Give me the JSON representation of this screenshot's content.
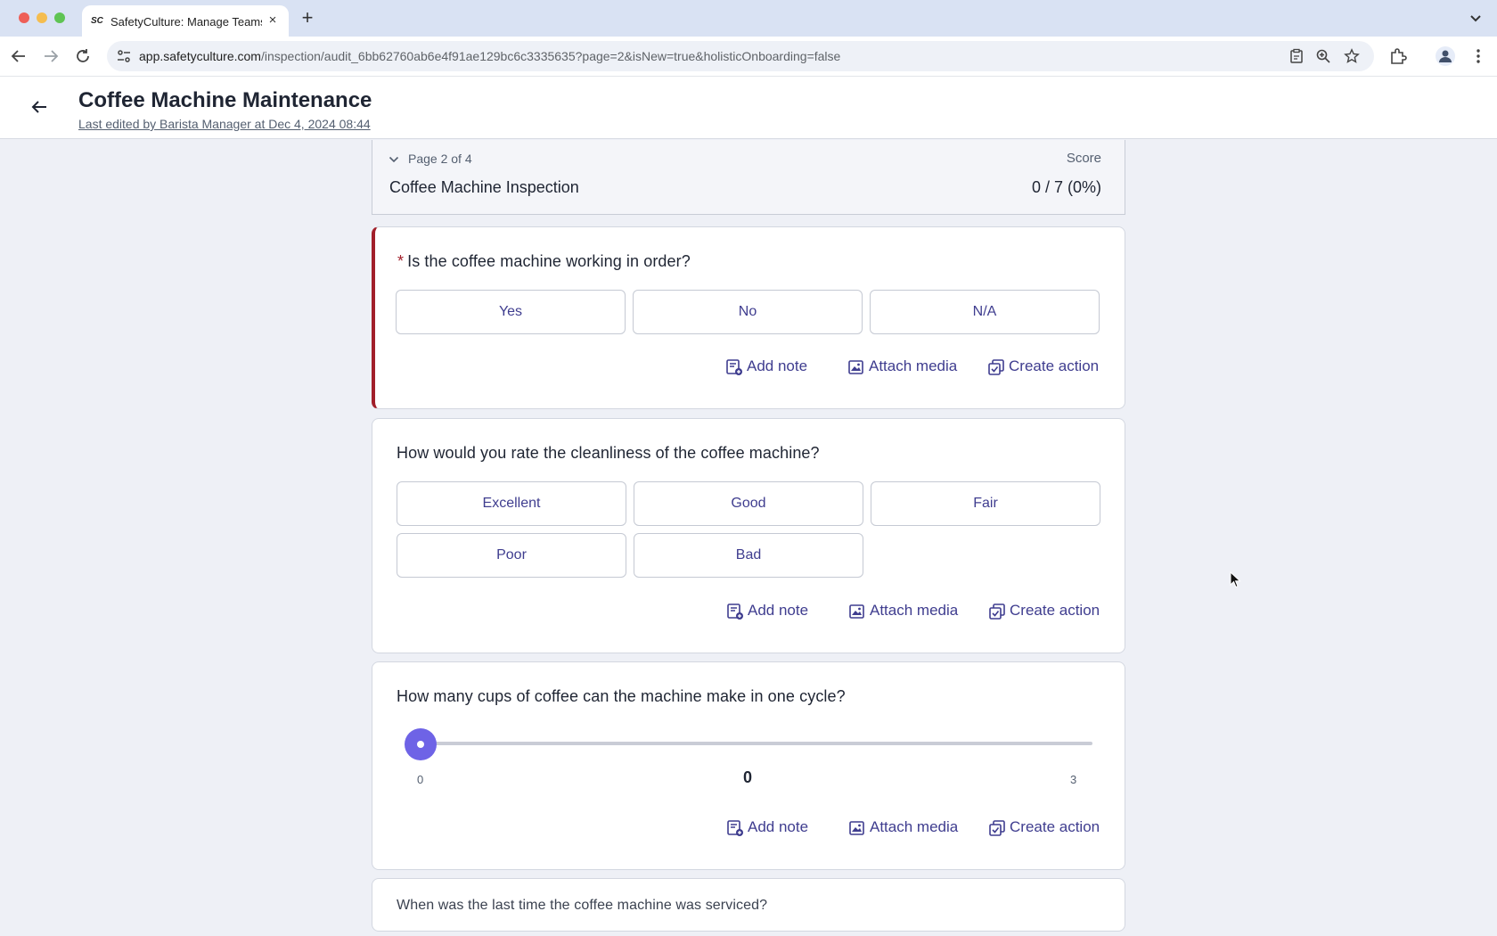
{
  "browser": {
    "tab_title": "SafetyCulture: Manage Teams",
    "favicon_text": "SC",
    "url_host": "app.safetyculture.com",
    "url_path": "/inspection/audit_6bb62760ab6e4f91ae129bc6c3335635?page=2&isNew=true&holisticOnboarding=false"
  },
  "header": {
    "title": "Coffee Machine Maintenance",
    "last_edited": "Last edited by Barista Manager at Dec 4, 2024 08:44"
  },
  "page": {
    "label": "Page 2 of 4",
    "name": "Coffee Machine Inspection",
    "score_label": "Score",
    "score_value": "0 / 7 (0%)"
  },
  "actions": {
    "add_note": "Add note",
    "attach_media": "Attach media",
    "create_action": "Create action"
  },
  "questions": [
    {
      "text": "Is the coffee machine working in order?",
      "required_marker": "*",
      "options": [
        "Yes",
        "No",
        "N/A"
      ]
    },
    {
      "text": "How would you rate the cleanliness of the coffee machine?",
      "options": [
        "Excellent",
        "Good",
        "Fair",
        "Poor",
        "Bad"
      ]
    },
    {
      "text": "How many cups of coffee can the machine make in one cycle?",
      "slider": {
        "min": "0",
        "max": "3",
        "value": "0"
      }
    },
    {
      "text": "When was the last time the coffee machine was serviced?"
    }
  ],
  "colors": {
    "accent": "#3f3d8f",
    "slider_thumb": "#6e63e6",
    "required": "#a11f2a",
    "background": "#eef0f6"
  },
  "icons": [
    "back-icon",
    "forward-icon",
    "reload-icon",
    "site-info-icon",
    "clipboard-icon",
    "zoom-icon",
    "star-icon",
    "extensions-icon",
    "profile-icon",
    "menu-icon",
    "chevron-down-icon",
    "note-icon",
    "media-icon",
    "action-icon"
  ]
}
